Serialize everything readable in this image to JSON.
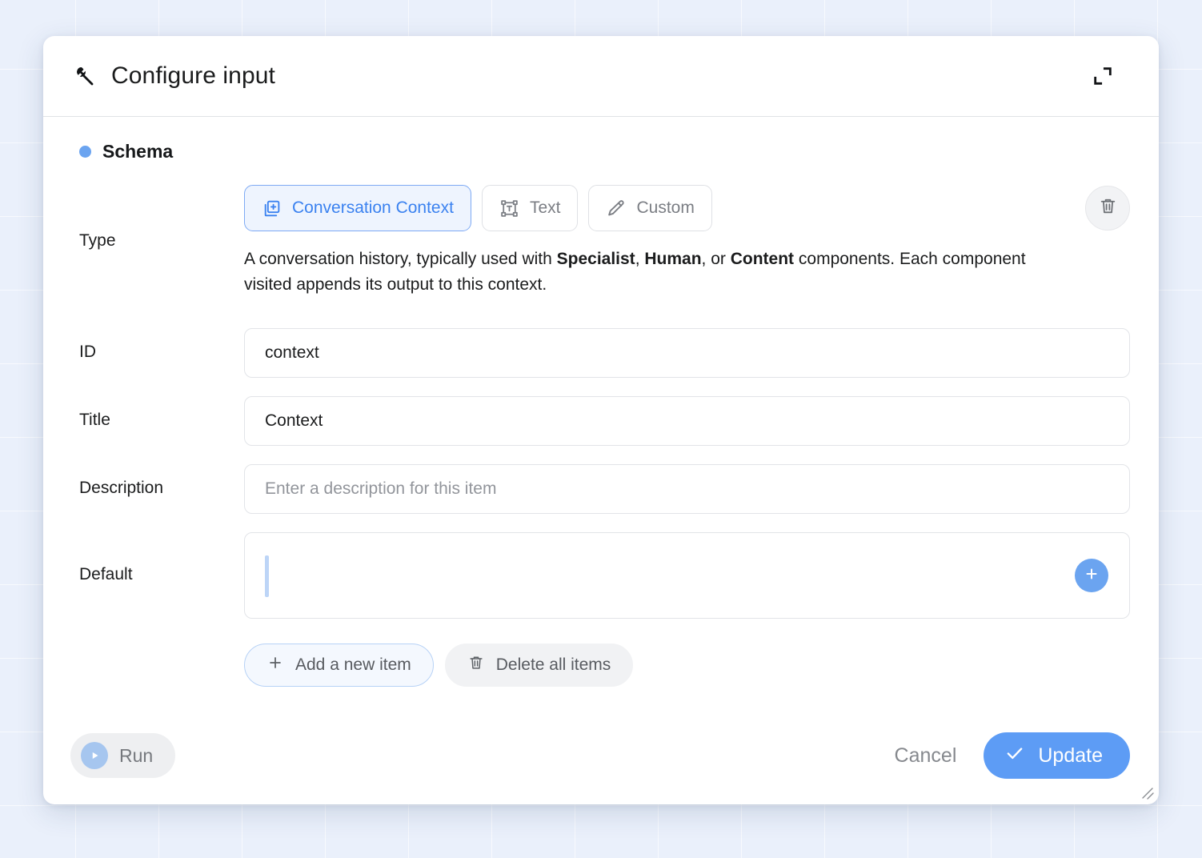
{
  "window": {
    "title": "Configure input",
    "title_icon": "wrench-icon",
    "expand_icon": "expand-icon",
    "resize_grip_icon": "resize-grip-icon"
  },
  "section": {
    "label": "Schema",
    "dot_color": "#6ba4f0"
  },
  "type_row": {
    "label": "Type",
    "options": [
      {
        "label": "Conversation Context",
        "icon": "library-add-icon",
        "selected": true
      },
      {
        "label": "Text",
        "icon": "text-box-icon",
        "selected": false
      },
      {
        "label": "Custom",
        "icon": "pencil-icon",
        "selected": false
      }
    ],
    "delete_icon": "trash-icon",
    "description_parts": [
      {
        "text": "A conversation history, typically used with ",
        "bold": false
      },
      {
        "text": "Specialist",
        "bold": true
      },
      {
        "text": ", ",
        "bold": false
      },
      {
        "text": "Human",
        "bold": true
      },
      {
        "text": ", or ",
        "bold": false
      },
      {
        "text": "Content",
        "bold": true
      },
      {
        "text": " components. Each component visited appends its output to this context.",
        "bold": false
      }
    ],
    "description_plain": "A conversation history, typically used with Specialist, Human, or Content components. Each component visited appends its output to this context."
  },
  "fields": {
    "id": {
      "label": "ID",
      "value": "context",
      "placeholder": ""
    },
    "title": {
      "label": "Title",
      "value": "Context",
      "placeholder": ""
    },
    "description": {
      "label": "Description",
      "value": "",
      "placeholder": "Enter a description for this item"
    },
    "default": {
      "label": "Default",
      "value": "",
      "add_icon": "plus-icon"
    }
  },
  "item_actions": {
    "add": {
      "label": "Add a new item",
      "icon": "plus-icon"
    },
    "delete_all": {
      "label": "Delete all items",
      "icon": "trash-icon"
    }
  },
  "footer": {
    "run": {
      "label": "Run",
      "icon": "play-icon"
    },
    "cancel": {
      "label": "Cancel"
    },
    "update": {
      "label": "Update",
      "icon": "check-icon"
    }
  },
  "colors": {
    "accent": "#5d9cf5",
    "accent_light": "#6ba4f0",
    "selected_bg": "#eef4fe",
    "selected_border": "#7eaaf4",
    "canvas_bg": "#eaf0fb",
    "muted_text": "#7b7e84"
  }
}
